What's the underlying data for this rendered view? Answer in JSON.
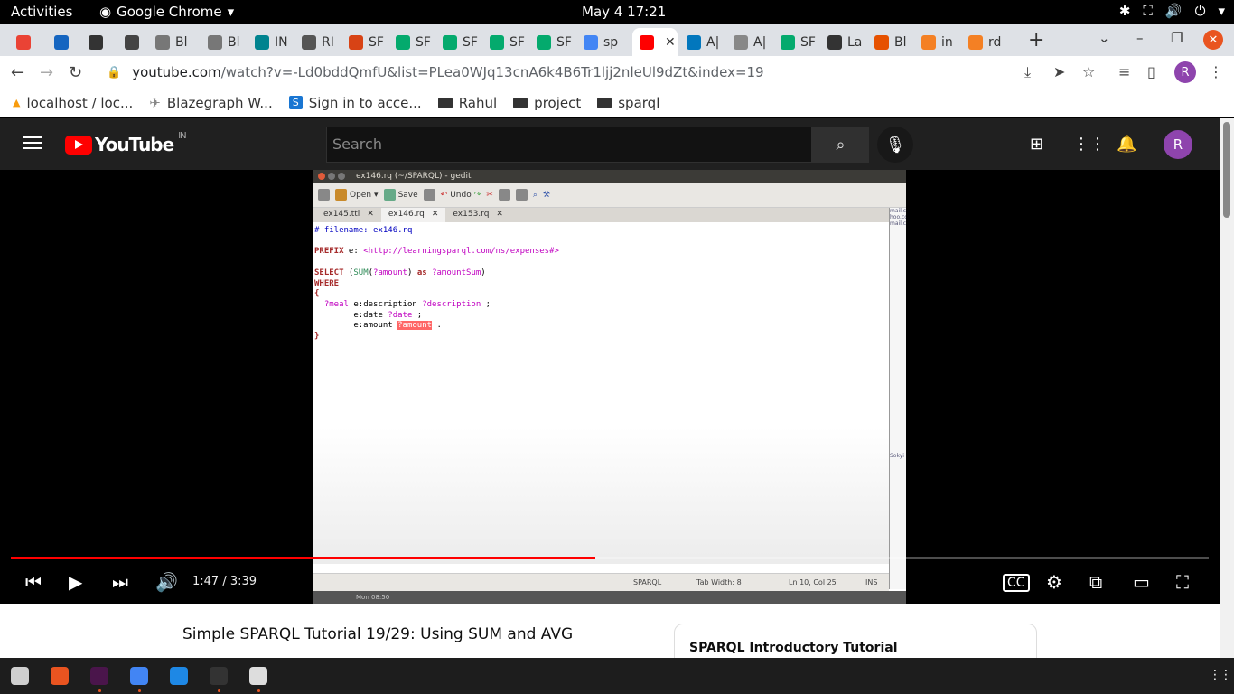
{
  "system": {
    "activities": "Activities",
    "app_name": "Google Chrome",
    "clock": "May 4  17:21"
  },
  "tabs": [
    {
      "label": "",
      "color": "#ea4335"
    },
    {
      "label": "",
      "color": "#1565c0"
    },
    {
      "label": "",
      "color": "#333333"
    },
    {
      "label": "",
      "color": "#444444"
    },
    {
      "label": "Bl",
      "color": "#777777"
    },
    {
      "label": "Bl",
      "color": "#777777"
    },
    {
      "label": "IN",
      "color": "#00838f"
    },
    {
      "label": "RI",
      "color": "#555555"
    },
    {
      "label": "SF",
      "color": "#d84315"
    },
    {
      "label": "SF",
      "color": "#04aa6d"
    },
    {
      "label": "SF",
      "color": "#04aa6d"
    },
    {
      "label": "SF",
      "color": "#04aa6d"
    },
    {
      "label": "SF",
      "color": "#04aa6d"
    },
    {
      "label": "sp",
      "color": "#4285f4"
    },
    {
      "label": "",
      "color": "#ff0000"
    },
    {
      "label": "A|",
      "color": "#0277bd"
    },
    {
      "label": "A|",
      "color": "#888888"
    },
    {
      "label": "SF",
      "color": "#04aa6d"
    },
    {
      "label": "La",
      "color": "#333333"
    },
    {
      "label": "Bl",
      "color": "#e65100"
    },
    {
      "label": "in",
      "color": "#f48024"
    },
    {
      "label": "rd",
      "color": "#f48024"
    }
  ],
  "omnibox": {
    "domain": "youtube.com",
    "path": "/watch?v=-Ld0bddQmfU&list=PLea0WJq13cnA6k4B6Tr1ljj2nleUl9dZt&index=19"
  },
  "profile_initial": "R",
  "bookmarks": [
    {
      "label": "localhost / loc...",
      "icon": "phpmyadmin-icon"
    },
    {
      "label": "Blazegraph W...",
      "icon": "blazegraph-icon"
    },
    {
      "label": "Sign in to acce...",
      "icon": "s-icon"
    },
    {
      "label": "Rahul",
      "icon": "folder-icon"
    },
    {
      "label": "project",
      "icon": "folder-icon"
    },
    {
      "label": "sparql",
      "icon": "folder-icon"
    }
  ],
  "youtube": {
    "logo_text": "YouTube",
    "region": "IN",
    "search_placeholder": "Search",
    "avatar_initial": "R"
  },
  "video": {
    "gedit_title": "ex146.rq (~/SPARQL) - gedit",
    "toolbar": {
      "open": "Open",
      "save": "Save",
      "undo": "Undo"
    },
    "doc_tabs": [
      "ex145.ttl",
      "ex146.rq",
      "ex153.rq"
    ],
    "status": {
      "lang": "SPARQL",
      "tab_width": "Tab Width:  8",
      "position": "Ln 10, Col 25",
      "mode": "INS",
      "panel_clock": "Mon 08:50"
    },
    "side_text": [
      "mail.c",
      "hoo.co",
      "mail.co",
      "Sokyi"
    ],
    "current_time": "1:47",
    "duration": "3:39",
    "time_display": "1:47 / 3:39",
    "progress": 0.488
  },
  "code_lines": {
    "l1": "# filename: ex146.rq",
    "l2_kw": "PREFIX",
    "l2_pre": " e: ",
    "l2_uri": "<http://learningsparql.com/ns/expenses#>",
    "l3_kw": "SELECT",
    "l3_a": " (",
    "l3_fn": "SUM",
    "l3_b": "(",
    "l3_v1": "?amount",
    "l3_c": ") ",
    "l3_as": "as",
    "l3_d": " ",
    "l3_v2": "?amountSum",
    "l3_e": ")",
    "l4_kw": "WHERE",
    "l5": "{",
    "l6_v": "  ?meal",
    "l6_p": " e:description ",
    "l6_v2": "?description",
    "l6_e": " ;",
    "l7_p": "        e:date ",
    "l7_v": "?date",
    "l7_e": " ;",
    "l8_p": "        e:amount ",
    "l8_v": "?amount",
    "l8_e": " .",
    "l9": "}"
  },
  "page": {
    "video_title": "Simple SPARQL Tutorial 19/29: Using SUM and AVG",
    "playlist_title": "SPARQL Introductory Tutorial"
  },
  "dock_apps": [
    {
      "name": "files",
      "color": "#cfcfcf"
    },
    {
      "name": "software",
      "color": "#e95420"
    },
    {
      "name": "slack",
      "color": "#4a154b"
    },
    {
      "name": "chrome",
      "color": "#4285f4"
    },
    {
      "name": "vscode",
      "color": "#1e88e5"
    },
    {
      "name": "terminal",
      "color": "#333333"
    },
    {
      "name": "text-editor",
      "color": "#dddddd"
    }
  ]
}
